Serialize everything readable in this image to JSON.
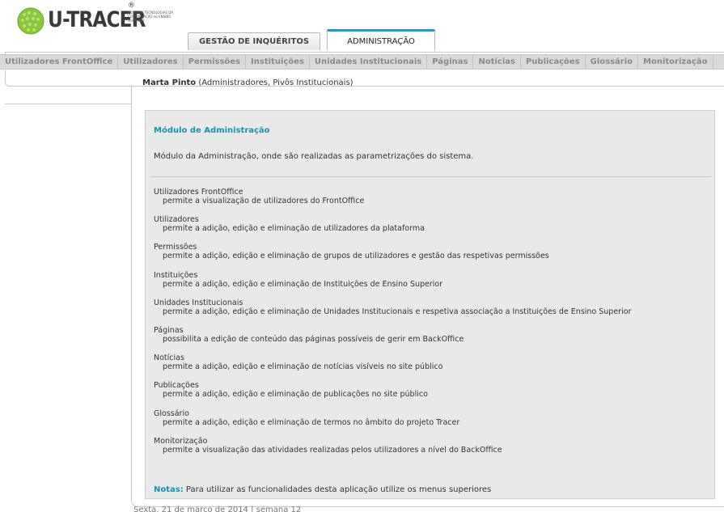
{
  "logo": {
    "text": "U-TRACER",
    "reg": "®",
    "subtitle": "MONITOR TECNOLOGIAS DA COMUNICAÇÃO no ENSINO SUPERIOR",
    "globe_color": "#8cc63f"
  },
  "tabs": [
    {
      "label": "GESTÃO DE INQUÉRITOS",
      "active": false
    },
    {
      "label": "ADMINISTRAÇÃO",
      "active": true
    }
  ],
  "subnav": [
    "Utilizadores FrontOffice",
    "Utilizadores",
    "Permissões",
    "Instituições",
    "Unidades Institucionais",
    "Páginas",
    "Notícias",
    "Publicações",
    "Glossário",
    "Monitorização"
  ],
  "user": {
    "name": "Marta Pinto",
    "roles": "(Administradores, Pivôs Institucionais)"
  },
  "panel": {
    "title": "Módulo de Administração",
    "description": "Módulo da Administração, onde são realizadas as parametrizações do sistema.",
    "items": [
      {
        "name": "Utilizadores FrontOffice",
        "desc": "permite a visualização de utilizadores do FrontOffice"
      },
      {
        "name": "Utilizadores",
        "desc": "permite a adição, edição e eliminação de utilizadores da plataforma"
      },
      {
        "name": "Permissões",
        "desc": "permite a adição, edição e eliminação de grupos de utilizadores e gestão das respetivas permissões"
      },
      {
        "name": "Instituições",
        "desc": "permite a adição, edição e eliminação de Instituições de Ensino Superior"
      },
      {
        "name": "Unidades Institucionais",
        "desc": "permite a adição, edição e eliminação de Unidades Institucionais e respetiva associação a Instituições de Ensino Superior"
      },
      {
        "name": "Páginas",
        "desc": "possibilita a edição de conteúdo das páginas possíveis de gerir em BackOffice"
      },
      {
        "name": "Notícias",
        "desc": "permite a adição, edição e eliminação de notícias visíveis no site público"
      },
      {
        "name": "Publicações",
        "desc": "permite a adição, edição e eliminação de publicações no site público"
      },
      {
        "name": "Glossário",
        "desc": "permite a adição, edição e eliminação de termos no âmbito do projeto Tracer"
      },
      {
        "name": "Monitorização",
        "desc": "permite a visualização das atividades realizadas pelos utilizadores a nível do BackOffice"
      }
    ],
    "notes_label": "Notas:",
    "notes_text": "Para utilizar as funcionalidades desta aplicação utilize os menus superiores"
  },
  "footer": {
    "date": "Sexta, 21 de março de 2014 | semana 12"
  },
  "colors": {
    "accent": "#1a8fb0",
    "panel_bg": "#e9e9e9",
    "subnav_bg": "#d9d9d9"
  }
}
